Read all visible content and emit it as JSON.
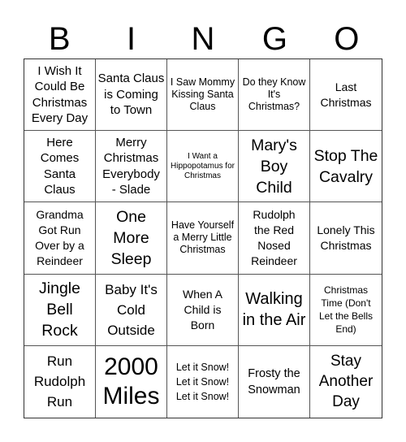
{
  "header": [
    "B",
    "I",
    "N",
    "G",
    "O"
  ],
  "cells": [
    "I Wish It Could Be Christmas Every Day",
    "Santa Claus is Coming to Town",
    "I Saw Mommy Kissing Santa Claus",
    "Do they Know It's Christmas?",
    "Last Christmas",
    "Here Comes Santa Claus",
    "Merry Christmas Everybody - Slade",
    "I Want a Hippopotamus for Christmas",
    "Mary's Boy Child",
    "Stop The Cavalry",
    "Grandma Got Run Over by a Reindeer",
    "One More Sleep",
    "Have Yourself a Merry Little Christmas",
    "Rudolph the Red Nosed Reindeer",
    "Lonely This Christmas",
    "Jingle Bell Rock",
    "Baby It's Cold Outside",
    "When A Child is Born",
    "Walking in the Air",
    "Christmas Time (Don't Let the Bells End)",
    "Run Rudolph Run",
    "2000 Miles",
    "Let it Snow! Let it Snow! Let it Snow!",
    "Frosty the Snowman",
    "Stay Another Day"
  ]
}
